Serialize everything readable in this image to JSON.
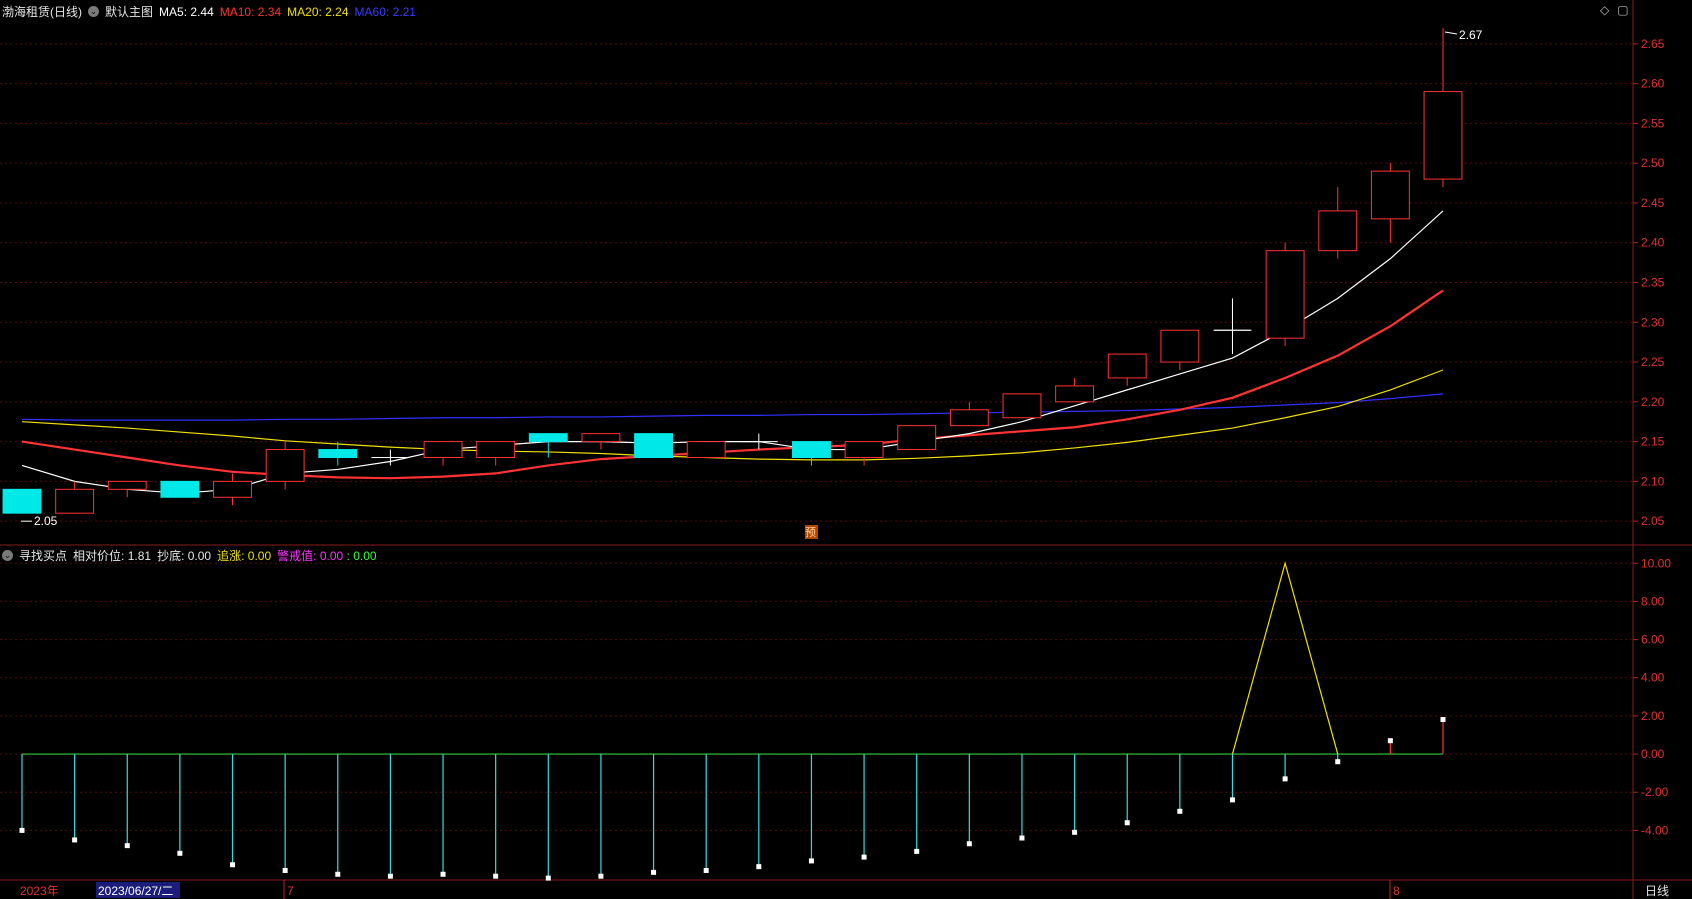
{
  "header": {
    "stock_name": "渤海租赁",
    "period_paren": "(日线)",
    "main_chart_label": "默认主图",
    "ma5": {
      "label": "MA5:",
      "value": "2.44",
      "color": "#ffffff"
    },
    "ma10": {
      "label": "MA10:",
      "value": "2.34",
      "color": "#ff3333"
    },
    "ma20": {
      "label": "MA20:",
      "value": "2.24",
      "color": "#f0e000"
    },
    "ma60": {
      "label": "MA60:",
      "value": "2.21",
      "color": "#3030ff"
    }
  },
  "indicator_header": {
    "name": "寻找买点",
    "rel_label": "相对价位:",
    "rel_value": "1.81",
    "bottom_label": "抄底:",
    "bottom_value": "0.00",
    "chase_label": "追涨:",
    "chase_value": "0.00",
    "warn_label": "警戒值:",
    "warn_value": "0.00",
    "sep": ":",
    "last_value": "0.00"
  },
  "bottom_bar": {
    "start_label": "2023年",
    "date_label": "2023/06/27/二",
    "month7": "7",
    "month8": "8",
    "period": "日线"
  },
  "top_right_icons": {
    "diamond": "◇",
    "box": "▢"
  },
  "chart_data": [
    {
      "type": "candlestick",
      "ylim": [
        2.02,
        2.68
      ],
      "yticks": [
        "2.05",
        "2.10",
        "2.15",
        "2.20",
        "2.25",
        "2.30",
        "2.35",
        "2.40",
        "2.45",
        "2.50",
        "2.55",
        "2.60",
        "2.65"
      ],
      "max_label": "2.67",
      "min_label": "2.05",
      "marker": "预",
      "candles": [
        {
          "o": 2.09,
          "h": 2.09,
          "l": 2.06,
          "c": 2.06
        },
        {
          "o": 2.06,
          "h": 2.1,
          "l": 2.06,
          "c": 2.09
        },
        {
          "o": 2.09,
          "h": 2.1,
          "l": 2.08,
          "c": 2.1
        },
        {
          "o": 2.1,
          "h": 2.1,
          "l": 2.08,
          "c": 2.08
        },
        {
          "o": 2.08,
          "h": 2.11,
          "l": 2.07,
          "c": 2.1
        },
        {
          "o": 2.1,
          "h": 2.15,
          "l": 2.09,
          "c": 2.14
        },
        {
          "o": 2.14,
          "h": 2.15,
          "l": 2.12,
          "c": 2.13
        },
        {
          "o": 2.13,
          "h": 2.14,
          "l": 2.12,
          "c": 2.13
        },
        {
          "o": 2.13,
          "h": 2.15,
          "l": 2.12,
          "c": 2.15
        },
        {
          "o": 2.13,
          "h": 2.15,
          "l": 2.12,
          "c": 2.15
        },
        {
          "o": 2.16,
          "h": 2.16,
          "l": 2.13,
          "c": 2.15
        },
        {
          "o": 2.15,
          "h": 2.16,
          "l": 2.14,
          "c": 2.16
        },
        {
          "o": 2.16,
          "h": 2.16,
          "l": 2.13,
          "c": 2.13
        },
        {
          "o": 2.13,
          "h": 2.15,
          "l": 2.13,
          "c": 2.15
        },
        {
          "o": 2.15,
          "h": 2.16,
          "l": 2.14,
          "c": 2.15
        },
        {
          "o": 2.15,
          "h": 2.15,
          "l": 2.12,
          "c": 2.13
        },
        {
          "o": 2.13,
          "h": 2.15,
          "l": 2.12,
          "c": 2.15
        },
        {
          "o": 2.14,
          "h": 2.17,
          "l": 2.14,
          "c": 2.17
        },
        {
          "o": 2.17,
          "h": 2.2,
          "l": 2.17,
          "c": 2.19
        },
        {
          "o": 2.18,
          "h": 2.21,
          "l": 2.18,
          "c": 2.21
        },
        {
          "o": 2.2,
          "h": 2.23,
          "l": 2.2,
          "c": 2.22
        },
        {
          "o": 2.23,
          "h": 2.26,
          "l": 2.22,
          "c": 2.26
        },
        {
          "o": 2.25,
          "h": 2.29,
          "l": 2.24,
          "c": 2.29
        },
        {
          "o": 2.29,
          "h": 2.33,
          "l": 2.26,
          "c": 2.29
        },
        {
          "o": 2.28,
          "h": 2.4,
          "l": 2.27,
          "c": 2.39
        },
        {
          "o": 2.39,
          "h": 2.47,
          "l": 2.38,
          "c": 2.44
        },
        {
          "o": 2.43,
          "h": 2.5,
          "l": 2.4,
          "c": 2.49
        },
        {
          "o": 2.48,
          "h": 2.67,
          "l": 2.47,
          "c": 2.59
        }
      ],
      "ma5": [
        2.12,
        2.1,
        2.09,
        2.085,
        2.09,
        2.11,
        2.115,
        2.125,
        2.14,
        2.145,
        2.15,
        2.15,
        2.148,
        2.15,
        2.15,
        2.14,
        2.14,
        2.15,
        2.16,
        2.175,
        2.195,
        2.215,
        2.235,
        2.255,
        2.29,
        2.33,
        2.38,
        2.44
      ],
      "ma10": [
        2.15,
        2.14,
        2.13,
        2.12,
        2.112,
        2.108,
        2.105,
        2.104,
        2.106,
        2.11,
        2.12,
        2.128,
        2.132,
        2.136,
        2.14,
        2.143,
        2.146,
        2.153,
        2.158,
        2.163,
        2.168,
        2.178,
        2.19,
        2.205,
        2.23,
        2.258,
        2.295,
        2.34
      ],
      "ma20": [
        2.175,
        2.171,
        2.167,
        2.162,
        2.157,
        2.151,
        2.147,
        2.143,
        2.14,
        2.138,
        2.137,
        2.135,
        2.132,
        2.13,
        2.128,
        2.127,
        2.127,
        2.129,
        2.132,
        2.136,
        2.142,
        2.149,
        2.158,
        2.167,
        2.18,
        2.194,
        2.215,
        2.24
      ],
      "ma60": [
        2.178,
        2.177,
        2.177,
        2.177,
        2.177,
        2.178,
        2.178,
        2.179,
        2.18,
        2.18,
        2.181,
        2.181,
        2.182,
        2.183,
        2.183,
        2.184,
        2.184,
        2.185,
        2.186,
        2.187,
        2.188,
        2.189,
        2.191,
        2.193,
        2.196,
        2.199,
        2.204,
        2.21
      ]
    },
    {
      "type": "bar_line",
      "ylim": [
        -6.6,
        10.8
      ],
      "yticks": [
        "-4.00",
        "-2.00",
        "0.00",
        "2.00",
        "4.00",
        "6.00",
        "8.00",
        "10.00"
      ],
      "bars": [
        -4.0,
        -4.5,
        -4.8,
        -5.2,
        -5.8,
        -6.1,
        -6.3,
        -6.4,
        -6.3,
        -6.4,
        -6.5,
        -6.4,
        -6.2,
        -6.1,
        -5.9,
        -5.6,
        -5.4,
        -5.1,
        -4.7,
        -4.4,
        -4.1,
        -3.6,
        -3.0,
        -2.4,
        -1.3,
        -0.4,
        0.7,
        1.81
      ],
      "line_start_index": 23,
      "line_values": [
        0,
        10,
        0
      ]
    }
  ]
}
